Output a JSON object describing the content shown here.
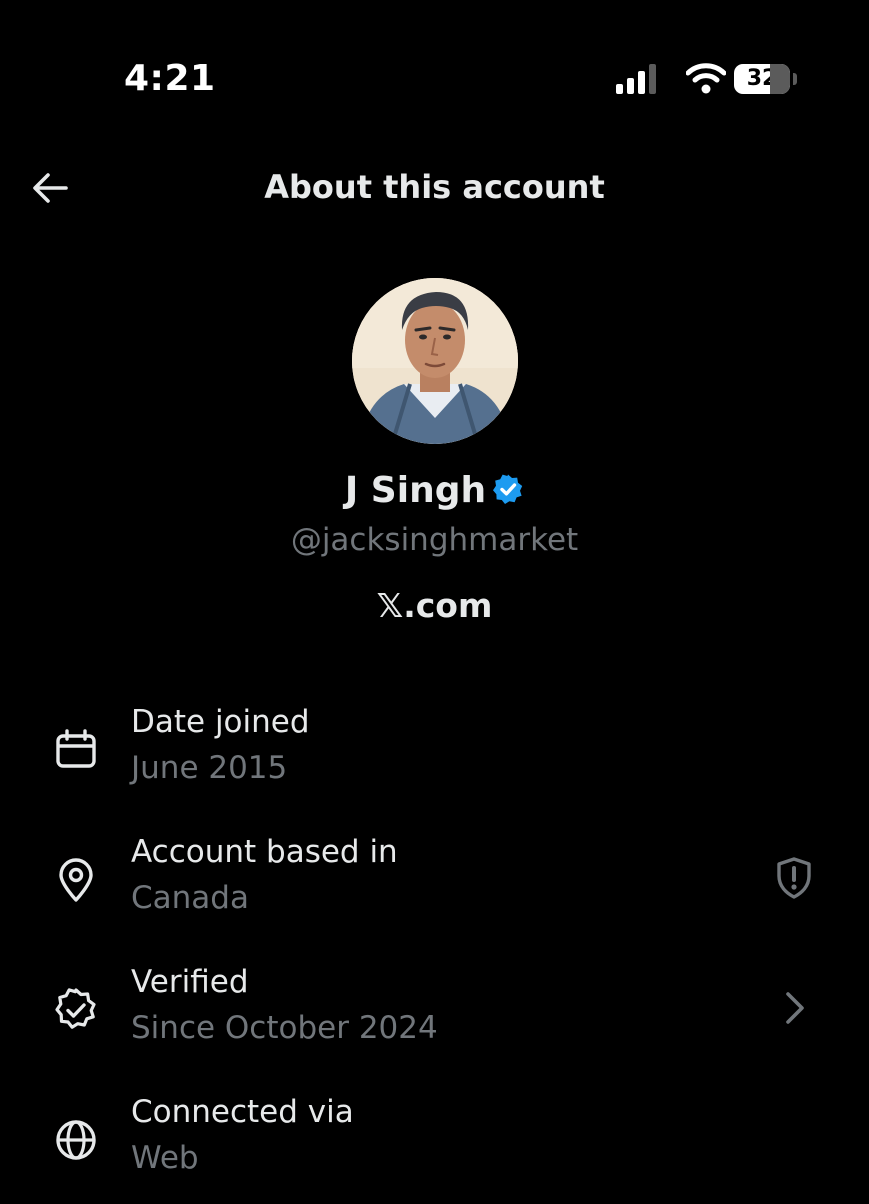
{
  "status_bar": {
    "time": "4:21",
    "battery_level": "32",
    "icons": [
      "cellular-signal-icon",
      "wifi-icon",
      "battery-icon"
    ]
  },
  "header": {
    "title": "About this account",
    "back_icon": "arrow-left-icon"
  },
  "profile": {
    "name": "J Singh",
    "handle": "@jacksinghmarket",
    "source": "𝕏.com",
    "verified_color": "#1d9bf0"
  },
  "info": [
    {
      "icon": "calendar-icon",
      "label": "Date joined",
      "value": "June 2015"
    },
    {
      "icon": "location-pin-icon",
      "label": "Account based in",
      "value": "Canada",
      "action_icon": "shield-alert-icon"
    },
    {
      "icon": "verified-badge-icon",
      "label": "Verified",
      "value": "Since October 2024",
      "action_icon": "chevron-right-icon"
    },
    {
      "icon": "globe-icon",
      "label": "Connected via",
      "value": "Web"
    }
  ],
  "colors": {
    "background": "#000000",
    "primary_text": "#e7e9ea",
    "secondary_text": "#71767b",
    "accent": "#1d9bf0"
  }
}
